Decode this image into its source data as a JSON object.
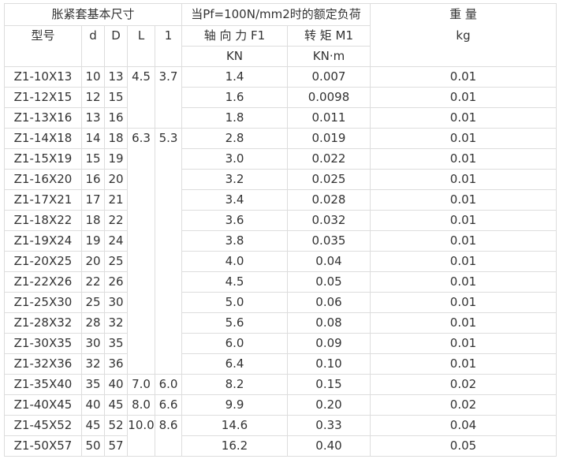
{
  "headers": {
    "group_dimensions": "胀紧套基本尺寸",
    "group_load": "当Pf=100N/mm2时的额定负荷",
    "weight": "重 量",
    "weight_unit": "kg",
    "model": "型号",
    "d": "d",
    "D": "D",
    "L": "L",
    "l": "1",
    "axial_force": "轴 向 力 F1",
    "axial_force_unit": "KN",
    "torque": "转 矩 M1",
    "torque_unit": "KN·m"
  },
  "rows": [
    {
      "model": "Z1-10X13",
      "d": "10",
      "D": "13",
      "F1": "1.4",
      "M1": "0.007",
      "weight": "0.01"
    },
    {
      "model": "Z1-12X15",
      "d": "12",
      "D": "15",
      "F1": "1.6",
      "M1": "0.0098",
      "weight": "0.01"
    },
    {
      "model": "Z1-13X16",
      "d": "13",
      "D": "16",
      "F1": "1.8",
      "M1": "0.011",
      "weight": "0.01"
    },
    {
      "model": "Z1-14X18",
      "d": "14",
      "D": "18",
      "F1": "2.8",
      "M1": "0.019",
      "weight": "0.01"
    },
    {
      "model": "Z1-15X19",
      "d": "15",
      "D": "19",
      "F1": "3.0",
      "M1": "0.022",
      "weight": "0.01"
    },
    {
      "model": "Z1-16X20",
      "d": "16",
      "D": "20",
      "F1": "3.2",
      "M1": "0.025",
      "weight": "0.01"
    },
    {
      "model": "Z1-17X21",
      "d": "17",
      "D": "21",
      "F1": "3.4",
      "M1": "0.028",
      "weight": "0.01"
    },
    {
      "model": "Z1-18X22",
      "d": "18",
      "D": "22",
      "F1": "3.6",
      "M1": "0.032",
      "weight": "0.01"
    },
    {
      "model": "Z1-19X24",
      "d": "19",
      "D": "24",
      "F1": "3.8",
      "M1": "0.035",
      "weight": "0.01"
    },
    {
      "model": "Z1-20X25",
      "d": "20",
      "D": "25",
      "F1": "4.0",
      "M1": "0.04",
      "weight": "0.01"
    },
    {
      "model": "Z1-22X26",
      "d": "22",
      "D": "26",
      "F1": "4.5",
      "M1": "0.05",
      "weight": "0.01"
    },
    {
      "model": "Z1-25X30",
      "d": "25",
      "D": "30",
      "F1": "5.0",
      "M1": "0.06",
      "weight": "0.01"
    },
    {
      "model": "Z1-28X32",
      "d": "28",
      "D": "32",
      "F1": "5.6",
      "M1": "0.08",
      "weight": "0.01"
    },
    {
      "model": "Z1-30X35",
      "d": "30",
      "D": "35",
      "F1": "6.0",
      "M1": "0.09",
      "weight": "0.01"
    },
    {
      "model": "Z1-32X36",
      "d": "32",
      "D": "36",
      "F1": "6.4",
      "M1": "0.10",
      "weight": "0.01"
    },
    {
      "model": "Z1-35X40",
      "d": "35",
      "D": "40",
      "F1": "8.2",
      "M1": "0.15",
      "weight": "0.02"
    },
    {
      "model": "Z1-40X45",
      "d": "40",
      "D": "45",
      "F1": "9.9",
      "M1": "0.20",
      "weight": "0.02"
    },
    {
      "model": "Z1-45X52",
      "d": "45",
      "D": "52",
      "F1": "14.6",
      "M1": "0.33",
      "weight": "0.04"
    },
    {
      "model": "Z1-50X57",
      "d": "50",
      "D": "57",
      "F1": "16.2",
      "M1": "0.40",
      "weight": "0.05"
    }
  ],
  "merged": [
    {
      "L": "4.5",
      "l": "3.7"
    },
    {
      "L": "6.3",
      "l": "5.3"
    },
    {
      "L": "7.0",
      "l": "6.0"
    },
    {
      "L": "8.0",
      "l": "6.6"
    },
    {
      "L": "10.0",
      "l": "8.6"
    }
  ]
}
